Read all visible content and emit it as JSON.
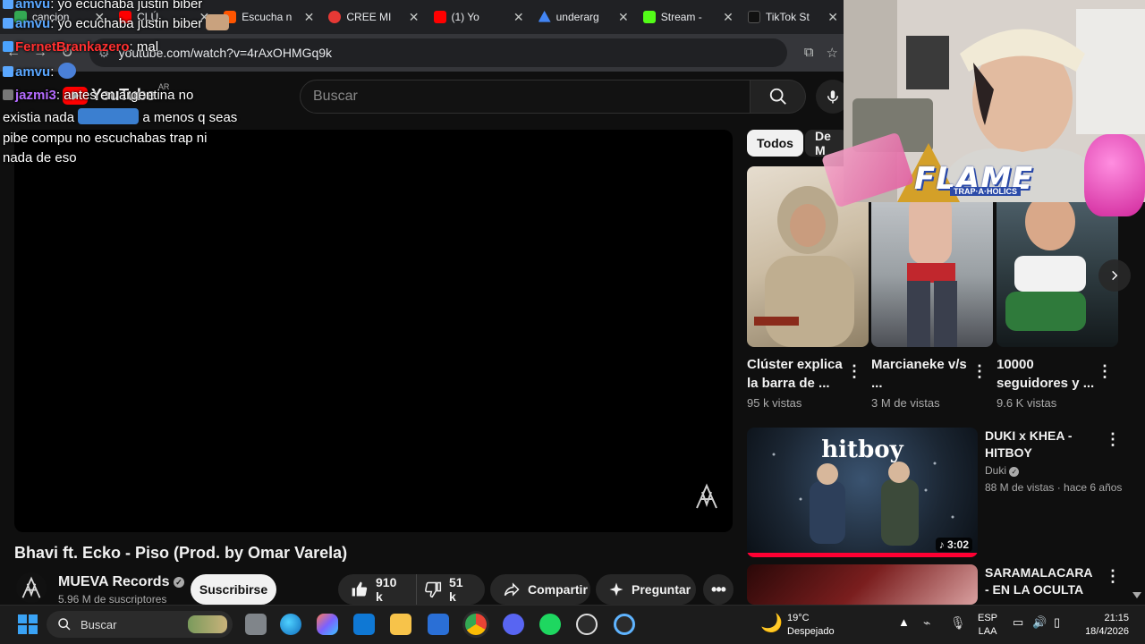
{
  "browser": {
    "tabs": [
      {
        "label": "cancion",
        "color": "#34a853"
      },
      {
        "label": "CLÚ",
        "color": "#ff0000"
      },
      {
        "label": "Escucha n",
        "color": "#ff5500"
      },
      {
        "label": "CREE MI",
        "color": "#e53935"
      },
      {
        "label": "(1) Yo",
        "color": "#ff0000"
      },
      {
        "label": "underarg",
        "color": "#4285f4"
      },
      {
        "label": "Stream -",
        "color": "#53fc18"
      },
      {
        "label": "TikTok St",
        "color": "#111111"
      }
    ],
    "url": "youtube.com/watch?v=4rAxOHMGq9k"
  },
  "chat": [
    {
      "user": "amvu",
      "user_color": "#5aa7ff",
      "text": "yo ecuchaba justin biber"
    },
    {
      "user": "FernetBrankazero",
      "user_color": "#ff3030",
      "text": "mal"
    },
    {
      "user": "amvu",
      "user_color": "#5aa7ff",
      "text": ""
    },
    {
      "user": "jazmi3",
      "user_color": "#b46bff",
      "text": "antes en argentina no"
    },
    {
      "user": "",
      "user_color": "#ffffff",
      "text": "existia nada"
    },
    {
      "user": "",
      "user_color": "#ffffff",
      "text": "a menos q seas"
    },
    {
      "user": "",
      "user_color": "#ffffff",
      "text": "pibe compu no escuchabas trap ni"
    },
    {
      "user": "",
      "user_color": "#ffffff",
      "text": "nada de eso"
    }
  ],
  "youtube": {
    "logo": "YouTube",
    "country": "AR",
    "search_placeholder": "Buscar",
    "video": {
      "title": "Bhavi ft. Ecko - Piso (Prod. by Omar Varela)",
      "channel": "MUEVA Records",
      "subscribers": "5.96 M de suscriptores",
      "subscribe_label": "Suscribirse",
      "likes": "910 k",
      "dislikes": "51 k",
      "share_label": "Compartir",
      "ask_label": "Preguntar"
    },
    "chips": [
      "Todos",
      "De M"
    ],
    "shorts": [
      {
        "title": "Clúster explica la barra de ...",
        "views": "95 k vistas"
      },
      {
        "title": "Marcianeke v/s ...",
        "views": "3 M de vistas"
      },
      {
        "title": "10000 seguidores y ...",
        "views": "9.6 K vistas"
      }
    ],
    "recommended": [
      {
        "title": "DUKI x KHEA - HITBOY",
        "channel": "Duki",
        "meta": "88 M de vistas · hace 6 años",
        "duration": "3:02",
        "thumb_text": "hitboy"
      },
      {
        "title": "SARAMALACARA - EN LA OCULTA ...",
        "channel": "",
        "meta": "",
        "duration": "",
        "thumb_text": ""
      }
    ]
  },
  "overlay": {
    "flame_title": "FLAME",
    "flame_sub": "TRAP·A·HOLICS"
  },
  "taskbar": {
    "search_label": "Buscar",
    "weather_temp": "19°C",
    "weather_desc": "Despejado",
    "lang_top": "ESP",
    "lang_bottom": "LAA",
    "time": "21:15",
    "date": "18/4/2026"
  }
}
